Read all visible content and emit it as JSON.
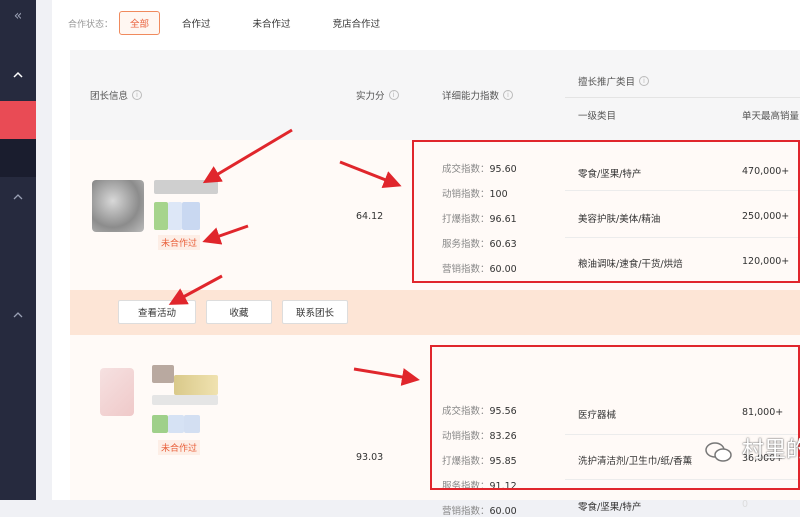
{
  "sidebar": {
    "collapse_icon": "«",
    "icons": [
      "chevron-up-icon",
      "chevron-up-icon",
      "chevron-up-icon"
    ]
  },
  "filter": {
    "label": "合作状态：",
    "options": [
      "全部",
      "合作过",
      "未合作过",
      "竞店合作过"
    ],
    "selected": "全部"
  },
  "table": {
    "headers": {
      "leader_info": "团长信息",
      "strength": "实力分",
      "detail_index": "详细能力指数",
      "category_group": "擅长推广类目",
      "level1": "一级类目",
      "daily_sales": "单天最高销量"
    },
    "rows": [
      {
        "status": "未合作过",
        "score": "64.12",
        "metrics": [
          {
            "label": "成交指数：",
            "value": "95.60"
          },
          {
            "label": "动销指数：",
            "value": "100"
          },
          {
            "label": "打爆指数：",
            "value": "96.61"
          },
          {
            "label": "服务指数：",
            "value": "60.63"
          },
          {
            "label": "营销指数：",
            "value": "60.00"
          }
        ],
        "categories": [
          {
            "name": "零食/坚果/特产",
            "sales": "470,000+"
          },
          {
            "name": "美容护肤/美体/精油",
            "sales": "250,000+"
          },
          {
            "name": "粮油调味/速食/干货/烘焙",
            "sales": "120,000+"
          }
        ]
      },
      {
        "status": "未合作过",
        "score": "93.03",
        "metrics": [
          {
            "label": "成交指数：",
            "value": "95.56"
          },
          {
            "label": "动销指数：",
            "value": "83.26"
          },
          {
            "label": "打爆指数：",
            "value": "95.85"
          },
          {
            "label": "服务指数：",
            "value": "91.12"
          },
          {
            "label": "营销指数：",
            "value": "60.00"
          }
        ],
        "categories": [
          {
            "name": "医疗器械",
            "sales": "81,000+"
          },
          {
            "name": "洗护清洁剂/卫生巾/纸/香薰",
            "sales": "36,000+"
          },
          {
            "name": "零食/坚果/特产",
            "sales": "0"
          }
        ]
      }
    ],
    "actions": [
      "查看活动",
      "收藏",
      "联系团长"
    ]
  },
  "watermark": {
    "text": "村里的"
  },
  "colors": {
    "accent": "#e9613c",
    "annotation_red": "#e0262c",
    "sidebar": "#262a3e",
    "action_bar": "#fde5d6"
  }
}
